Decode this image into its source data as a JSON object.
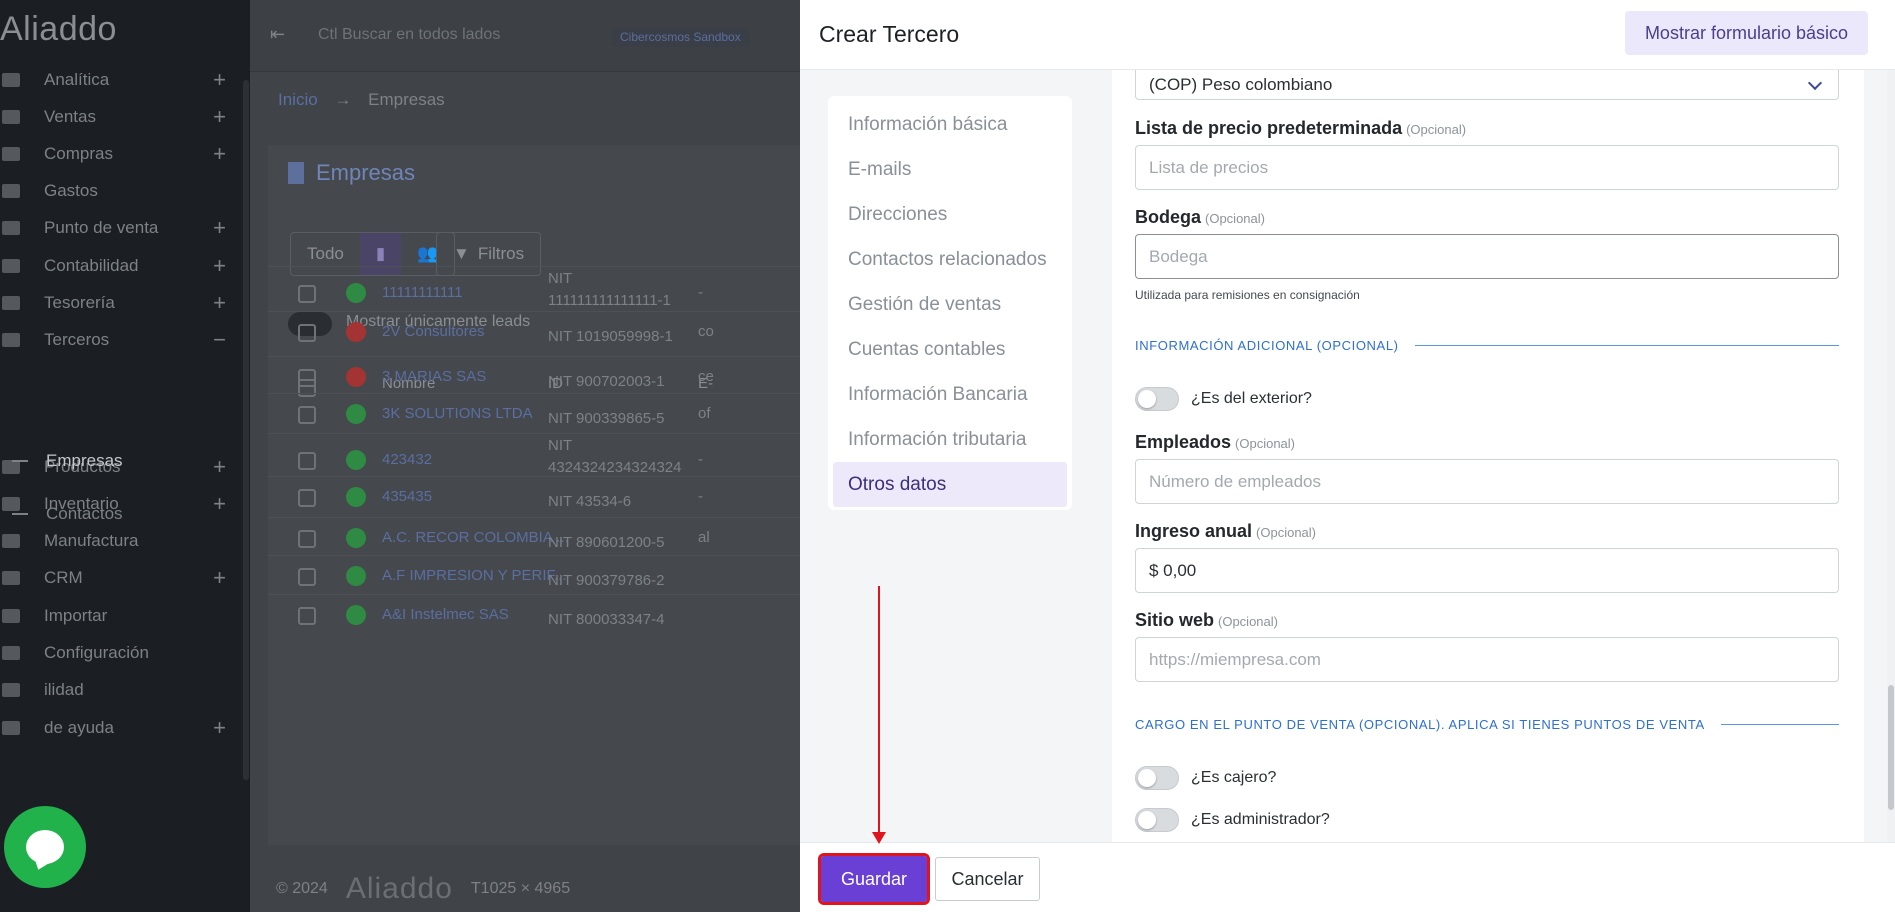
{
  "app": {
    "logo": "Aliaddo"
  },
  "sidebar": {
    "items": [
      {
        "label": "Analítica",
        "plus": "+"
      },
      {
        "label": "Ventas",
        "plus": "+"
      },
      {
        "label": "Compras",
        "plus": "+"
      },
      {
        "label": "Gastos",
        "plus": ""
      },
      {
        "label": "Punto de venta",
        "plus": "+"
      },
      {
        "label": "Contabilidad",
        "plus": "+"
      },
      {
        "label": "Tesorería",
        "plus": "+"
      },
      {
        "label": "Terceros",
        "plus": "−"
      },
      {
        "label": "Productos",
        "plus": "+"
      },
      {
        "label": "Inventario",
        "plus": "+"
      },
      {
        "label": "Manufactura",
        "plus": ""
      },
      {
        "label": "CRM",
        "plus": "+"
      },
      {
        "label": "Importar",
        "plus": ""
      },
      {
        "label": "Configuración",
        "plus": ""
      },
      {
        "label": "ilidad",
        "plus": ""
      },
      {
        "label": "de ayuda",
        "plus": "+"
      }
    ],
    "subitems": [
      "Empresas",
      "Contactos"
    ]
  },
  "topbar": {
    "search_placeholder": "Ctl Buscar en todos lados",
    "company": "Cibercosmos Sandbox"
  },
  "breadcrumb": {
    "home": "Inicio",
    "separator": "→",
    "current": "Empresas"
  },
  "list": {
    "title": "Empresas",
    "filter_all": "Todo",
    "filters_label": "Filtros",
    "leads_toggle_label": "Mostrar únicamente leads",
    "columns": {
      "name": "Nombre",
      "id": "ID",
      "email": "E-"
    },
    "rows": [
      {
        "name": "11111111111",
        "id": "NIT",
        "id2": "111111111111111-1",
        "email": "-",
        "status_color": "#2f8a43"
      },
      {
        "name": "2V Consultores",
        "id": "NIT 1019059998-1",
        "id2": "",
        "email": "co",
        "status_color": "#a43434"
      },
      {
        "name": "3 MARIAS SAS",
        "id": "NIT 900702003-1",
        "id2": "",
        "email": "ce",
        "status_color": "#a43434"
      },
      {
        "name": "3K SOLUTIONS LTDA",
        "id": "NIT 900339865-5",
        "id2": "",
        "email": "of",
        "status_color": "#2f8a43"
      },
      {
        "name": "423432",
        "id": "NIT",
        "id2": "4324324234324324",
        "email": "-",
        "status_color": "#2f8a43"
      },
      {
        "name": "435435",
        "id": "NIT 43534-6",
        "id2": "",
        "email": "-",
        "status_color": "#2f8a43"
      },
      {
        "name": "A.C. RECOR COLOMBIA ...",
        "id": "NIT 890601200-5",
        "id2": "",
        "email": "al",
        "status_color": "#2f8a43"
      },
      {
        "name": "A.F IMPRESION Y PERIF...",
        "id": "NIT 900379786-2",
        "id2": "",
        "email": "",
        "status_color": "#2f8a43"
      },
      {
        "name": "A&I Instelmec SAS",
        "id": "NIT 800033347-4",
        "id2": "",
        "email": "",
        "status_color": "#2f8a43"
      }
    ]
  },
  "footer": {
    "year": "© 2024",
    "logo": "Aliaddo",
    "resolution": "T1025 × 4965"
  },
  "modal": {
    "title": "Crear Tercero",
    "basic_form_button": "Mostrar formulario básico",
    "nav": [
      {
        "label": "Información básica",
        "selected": false
      },
      {
        "label": "E-mails",
        "selected": false
      },
      {
        "label": "Direcciones",
        "selected": false
      },
      {
        "label": "Contactos relacionados",
        "selected": false
      },
      {
        "label": "Gestión de ventas",
        "selected": false
      },
      {
        "label": "Cuentas contables",
        "selected": false
      },
      {
        "label": "Información Bancaria",
        "selected": false
      },
      {
        "label": "Información tributaria",
        "selected": false
      },
      {
        "label": "Otros datos",
        "selected": true
      }
    ],
    "currency_value": "(COP) Peso colombiano",
    "optional_tag": "(Opcional)",
    "price_list": {
      "label": "Lista de precio predeterminada",
      "placeholder": "Lista de precios"
    },
    "warehouse": {
      "label": "Bodega",
      "placeholder": "Bodega",
      "help": "Utilizada para remisiones en consignación"
    },
    "section_additional": "INFORMACIÓN ADICIONAL (OPCIONAL)",
    "foreign_toggle": "¿Es del exterior?",
    "employees": {
      "label": "Empleados",
      "placeholder": "Número de empleados"
    },
    "annual_income": {
      "label": "Ingreso anual",
      "value": "$ 0,00"
    },
    "website": {
      "label": "Sitio web",
      "placeholder": "https://miempresa.com"
    },
    "section_pos": "CARGO EN EL PUNTO DE VENTA (OPCIONAL). APLICA SI TIENES PUNTOS DE VENTA",
    "cashier_toggle": "¿Es cajero?",
    "admin_toggle": "¿Es administrador?",
    "save_button": "Guardar",
    "cancel_button": "Cancelar"
  },
  "colors": {
    "primary": "#6a3fd6",
    "highlight": "#e0141e",
    "section": "#2d6fd3"
  }
}
